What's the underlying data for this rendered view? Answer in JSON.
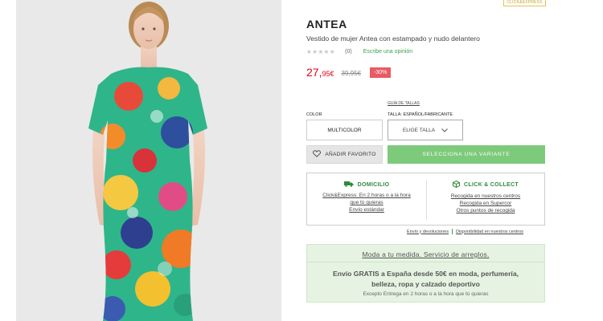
{
  "badge": {
    "label": "CLICK&EXPRESS"
  },
  "product": {
    "brand": "ANTEA",
    "subtitle": "Vestido de mujer Antea con estampado y nudo delantero",
    "rating_stars": "★★★★★",
    "review_count": "(0)",
    "write_review": "Escribe una opinión",
    "price_int": "27,",
    "price_dec": "95€",
    "old_price": "39,95€",
    "discount": "-30%"
  },
  "options": {
    "size_guide": "GUÍA DE TALLAS",
    "color_label": "COLOR",
    "color_value": "MULTICOLOR",
    "size_label": "TALLA: ESPAÑOL/FABRICANTE",
    "size_placeholder": "ELIGE TALLA"
  },
  "actions": {
    "favorite": "AÑADIR FAVORITO",
    "select_variant": "SELECCIONA UNA VARIANTE"
  },
  "delivery": {
    "home": {
      "title": "DOMICILIO",
      "links": [
        "Click&Express: En 2 horas o a la hora",
        "que tú quieras",
        "Envío estándar"
      ]
    },
    "collect": {
      "title": "CLICK & COLLECT",
      "links": [
        "Recogida en nuestros centros",
        "Recogida en Supercor",
        "Otros puntos de recogida"
      ]
    }
  },
  "links": {
    "shipping": "Envío y devoluciones",
    "availability": "Disponibilidad en nuestros centros"
  },
  "promo": {
    "title": "Moda a tu medida. Servicio de arreglos.",
    "main_1": "Envío GRATIS a España desde 50€ en moda, perfumería,",
    "main_2": "belleza, ropa y calzado deportivo",
    "note": "Excepto Entrega en 2 horas o a la hora que tú quieras"
  },
  "colors": {
    "accent_green": "#7dca7b",
    "price_red": "#e2001a",
    "discount_bg": "#e85a64",
    "promo_bg": "#e6f3e2"
  }
}
